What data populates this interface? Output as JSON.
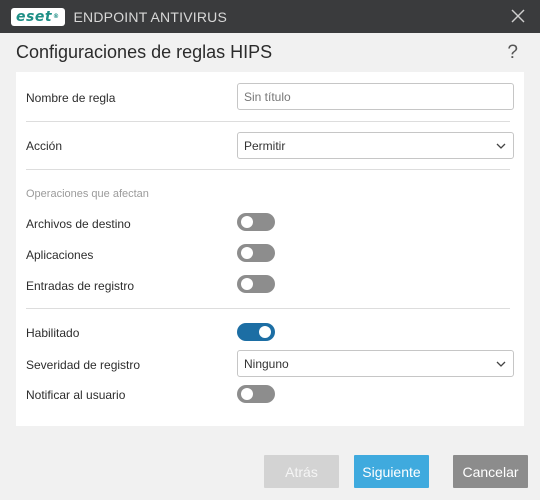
{
  "window": {
    "brand": "eset",
    "product": "ENDPOINT ANTIVIRUS",
    "close_icon": "close-icon"
  },
  "dialog": {
    "title": "Configuraciones de reglas HIPS",
    "help_label": "?"
  },
  "form": {
    "rule_name": {
      "label": "Nombre de regla",
      "value": "",
      "placeholder": "Sin título"
    },
    "action": {
      "label": "Acción",
      "value": "Permitir"
    },
    "operations_section": "Operaciones que afectan",
    "target_files": {
      "label": "Archivos de destino",
      "enabled": false
    },
    "applications": {
      "label": "Aplicaciones",
      "enabled": false
    },
    "registry_entries": {
      "label": "Entradas de registro",
      "enabled": false
    },
    "enabled": {
      "label": "Habilitado",
      "enabled": true
    },
    "log_severity": {
      "label": "Severidad de registro",
      "value": "Ninguno"
    },
    "notify_user": {
      "label": "Notificar al usuario",
      "enabled": false
    }
  },
  "buttons": {
    "back": "Atrás",
    "next": "Siguiente",
    "cancel": "Cancelar"
  },
  "colors": {
    "titlebar": "#3a3b3d",
    "accent": "#3faade",
    "toggle_on": "#1c6ea4",
    "toggle_off": "#8d8d8d"
  }
}
